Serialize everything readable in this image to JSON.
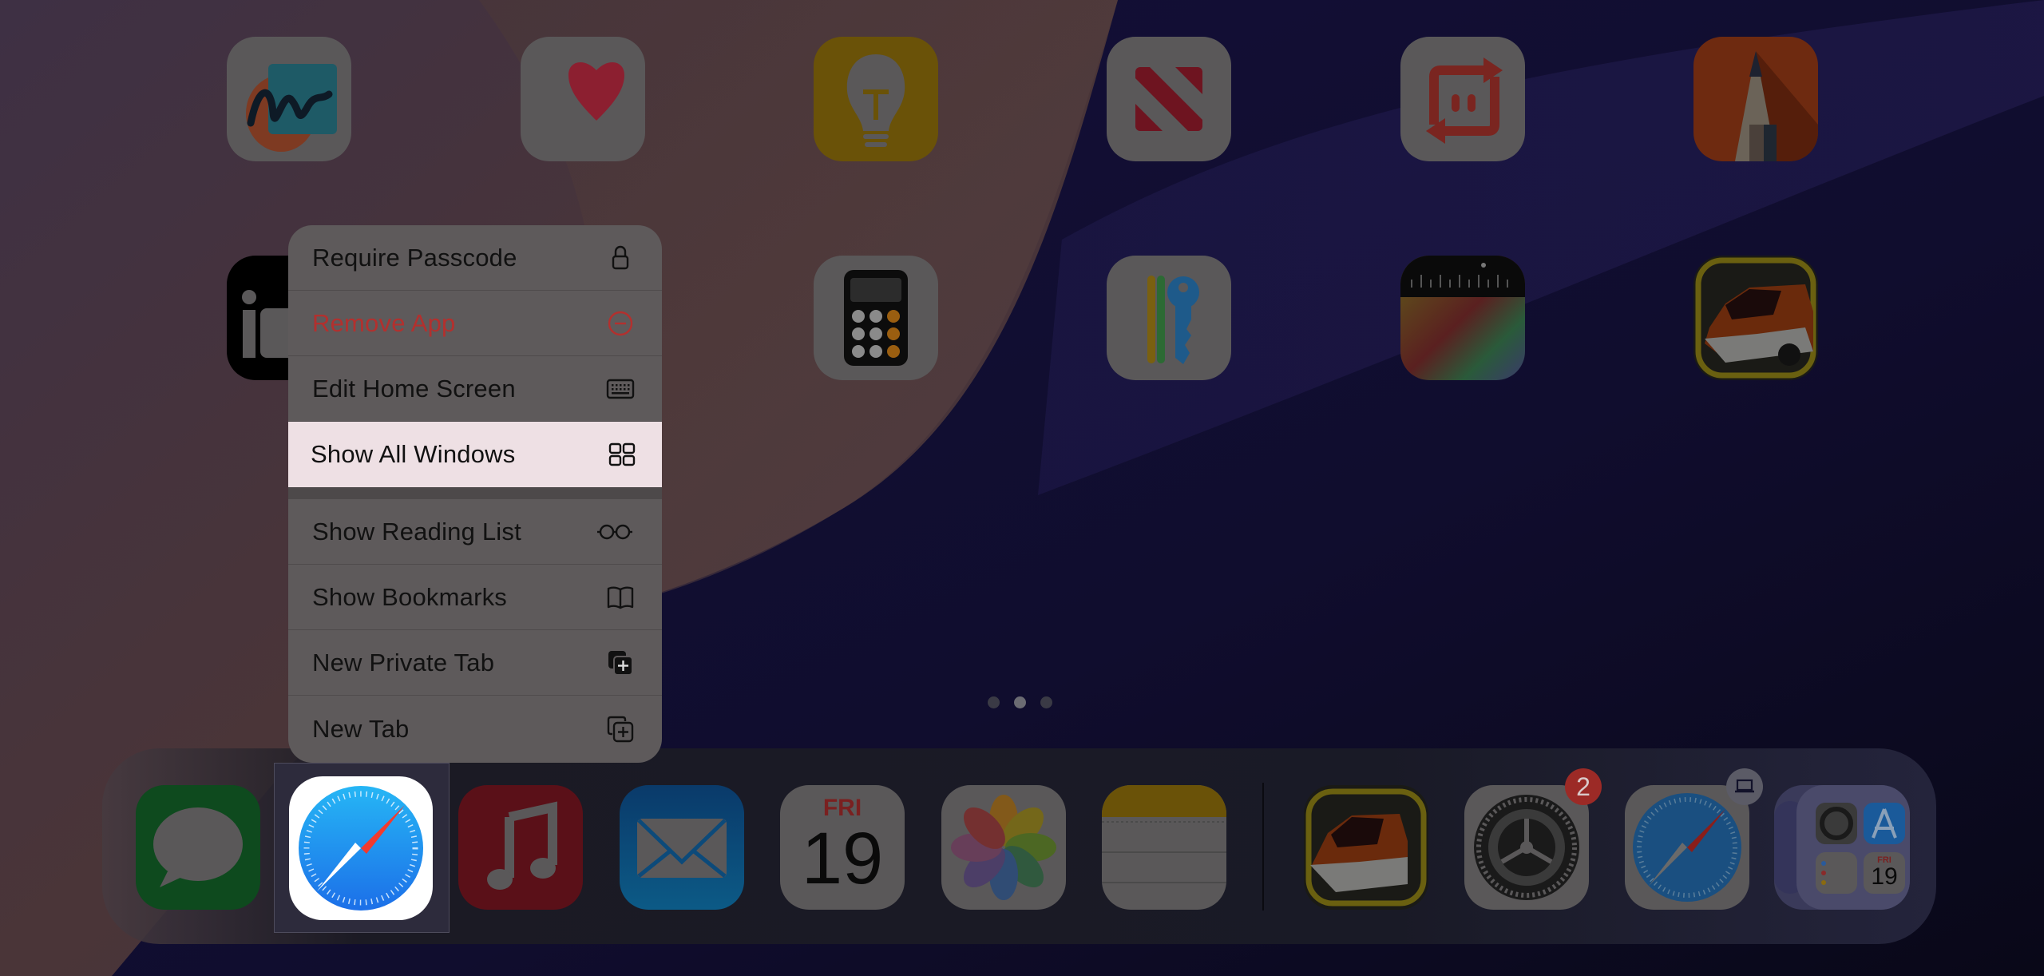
{
  "screen": {
    "type": "iPadOS Home Screen with app context menu",
    "current_page_index": 1,
    "page_count": 3
  },
  "home_icons": [
    {
      "name": "Freeform",
      "icon": "freeform-icon",
      "row": 1,
      "col": 1
    },
    {
      "name": "Health",
      "icon": "health-heart-icon",
      "row": 1,
      "col": 2
    },
    {
      "name": "Tips",
      "icon": "tips-lightbulb-icon",
      "row": 1,
      "col": 3
    },
    {
      "name": "News",
      "icon": "news-icon",
      "row": 1,
      "col": 4
    },
    {
      "name": "Send Anywhere",
      "icon": "transfer-app-icon",
      "row": 1,
      "col": 5
    },
    {
      "name": "Sketchbook",
      "icon": "pencil-app-icon",
      "row": 1,
      "col": 6
    },
    {
      "name": "iG",
      "icon": "ig-app-icon",
      "row": 2,
      "col": 1
    },
    {
      "name": "Calculator",
      "icon": "calculator-icon",
      "row": 2,
      "col": 3
    },
    {
      "name": "Passwords",
      "icon": "passwords-keys-icon",
      "row": 2,
      "col": 4
    },
    {
      "name": "Level",
      "icon": "level-meter-icon",
      "row": 2,
      "col": 5
    },
    {
      "name": "Dr. Driving",
      "icon": "car-game-icon",
      "row": 2,
      "col": 6
    }
  ],
  "context_menu": {
    "items": [
      {
        "label": "Require Passcode",
        "icon": "lock-icon",
        "style": "normal"
      },
      {
        "label": "Remove App",
        "icon": "minus-circle-icon",
        "style": "destructive"
      },
      {
        "label": "Edit Home Screen",
        "icon": "keyboard-icon",
        "style": "normal"
      },
      {
        "label": "Show All Windows",
        "icon": "grid-icon",
        "style": "highlighted"
      },
      {
        "label": "Show Reading List",
        "icon": "glasses-icon",
        "style": "normal"
      },
      {
        "label": "Show Bookmarks",
        "icon": "book-icon",
        "style": "normal"
      },
      {
        "label": "New Private Tab",
        "icon": "private-tab-plus-icon",
        "style": "normal"
      },
      {
        "label": "New Tab",
        "icon": "tab-plus-icon",
        "style": "normal"
      }
    ]
  },
  "dock": {
    "apps": [
      {
        "name": "Messages",
        "icon": "messages-icon"
      },
      {
        "name": "Safari",
        "icon": "safari-icon",
        "selected": true
      },
      {
        "name": "Music",
        "icon": "music-icon"
      },
      {
        "name": "Mail",
        "icon": "mail-icon"
      },
      {
        "name": "Calendar",
        "icon": "calendar-icon",
        "weekday": "FRI",
        "day": "19"
      },
      {
        "name": "Photos",
        "icon": "photos-icon"
      },
      {
        "name": "Notes",
        "icon": "notes-icon"
      }
    ],
    "recents": [
      {
        "name": "Dr. Driving",
        "icon": "car-game-icon"
      },
      {
        "name": "Settings",
        "icon": "settings-gear-icon",
        "badge": "2"
      },
      {
        "name": "Safari",
        "icon": "safari-icon",
        "handoff_badge": "laptop-icon"
      },
      {
        "name": "App Library",
        "icon": "app-library-folder-icon",
        "calendar_weekday": "FRI",
        "calendar_day": "19"
      }
    ]
  },
  "colors": {
    "destructive": "#b3302e",
    "highlight_row": "#eee0e4",
    "badge": "#9c2a26",
    "safari_blue": "#1e8ff0",
    "compass_red": "#e8352c"
  }
}
